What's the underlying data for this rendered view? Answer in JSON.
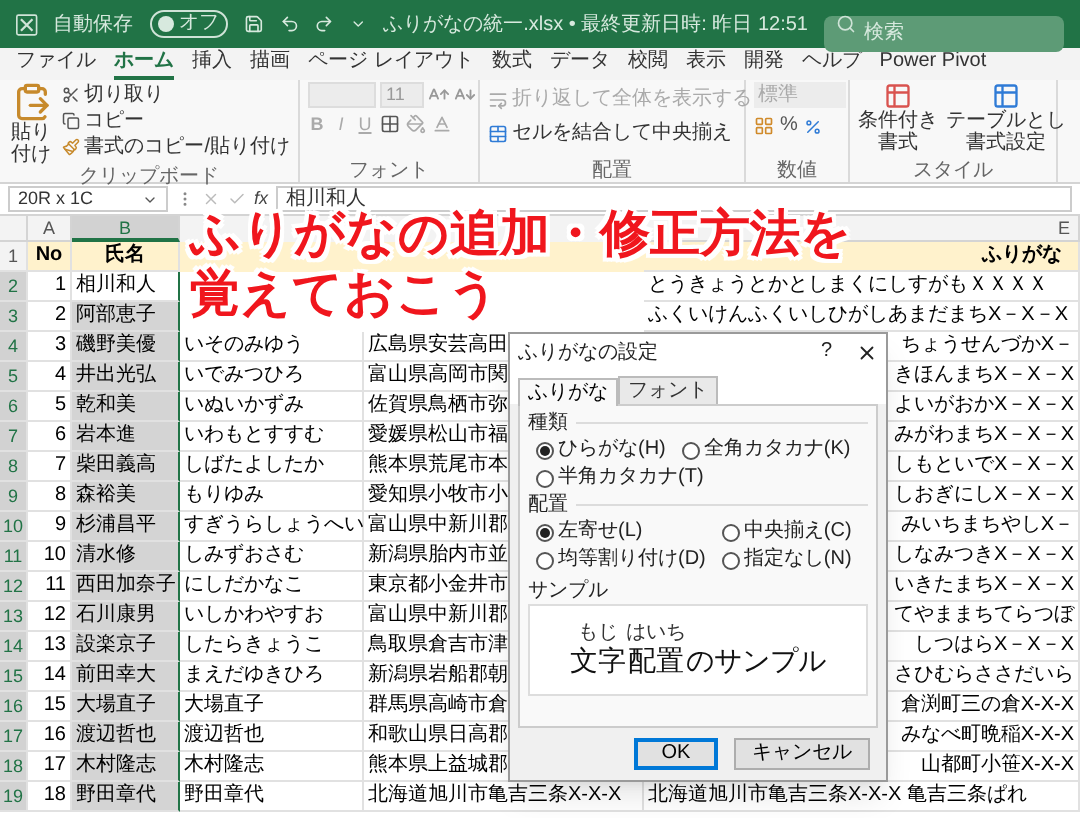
{
  "title_bar": {
    "autosave_label": "自動保存",
    "autosave_state": "オフ",
    "autosave_on": false,
    "file_title": "ふりがなの統一.xlsx • 最終更新日時: 昨日 12:51",
    "search_placeholder": "検索"
  },
  "menu_tabs": [
    {
      "label": "ファイル",
      "selected": false
    },
    {
      "label": "ホーム",
      "selected": true
    },
    {
      "label": "挿入",
      "selected": false
    },
    {
      "label": "描画",
      "selected": false
    },
    {
      "label": "ページ レイアウト",
      "selected": false
    },
    {
      "label": "数式",
      "selected": false
    },
    {
      "label": "データ",
      "selected": false
    },
    {
      "label": "校閲",
      "selected": false
    },
    {
      "label": "表示",
      "selected": false
    },
    {
      "label": "開発",
      "selected": false
    },
    {
      "label": "ヘルプ",
      "selected": false
    },
    {
      "label": "Power Pivot",
      "selected": false
    }
  ],
  "ribbon": {
    "clipboard": {
      "paste": "貼り付け",
      "cut": "切り取り",
      "copy": "コピー",
      "format_painter": "書式のコピー/貼り付け",
      "label": "クリップボード"
    },
    "font": {
      "size": "11",
      "styles": [
        "B",
        "I",
        "U"
      ],
      "label": "フォント"
    },
    "alignment": {
      "wrap": "折り返して全体を表示する",
      "merge": "セルを結合して中央揃え",
      "label": "配置"
    },
    "number": {
      "format": "標準",
      "percent": "%",
      "label": "数値"
    },
    "styles": {
      "conditional": [
        "条件付き",
        "書式"
      ],
      "table": [
        "テーブルとし",
        "書式設定"
      ],
      "label": "スタイル"
    }
  },
  "formula_bar": {
    "name_box": "20R x 1C",
    "function_label": "fx",
    "value": "相川和人"
  },
  "column_headers": {
    "a": {
      "letter": "A",
      "selected": false
    },
    "b": {
      "letter": "B",
      "selected": true
    },
    "e": {
      "letter": "E",
      "selected": false
    }
  },
  "header_row": {
    "row_number": "1",
    "no": "No",
    "name": "氏名",
    "kana2": "ふりがな"
  },
  "rows": [
    {
      "kind": "full",
      "row_number": "2",
      "selected": true,
      "active": true,
      "no": "1",
      "name": "相川和人",
      "kana2": "とうきょうとかとしまくにしすがもＸＸＸＸ"
    },
    {
      "kind": "full",
      "row_number": "3",
      "selected": true,
      "active": false,
      "no": "2",
      "name": "阿部恵子",
      "kana2": "ふくいけんふくいしひがしあまだまちX－X－X"
    },
    {
      "kind": "behind_dialog",
      "row_number": "4",
      "selected": true,
      "active": false,
      "no": "3",
      "name": "磯野美優",
      "kana": "いそのみゆう",
      "address": "広島県安芸高田",
      "kana2": "ちょうせんづかX－"
    },
    {
      "kind": "behind_dialog",
      "row_number": "5",
      "selected": true,
      "active": false,
      "no": "4",
      "name": "井出光弘",
      "kana": "いでみつひろ",
      "address": "富山県高岡市関",
      "kana2": "きほんまちX－X－X"
    },
    {
      "kind": "behind_dialog",
      "row_number": "6",
      "selected": true,
      "active": false,
      "no": "5",
      "name": "乾和美",
      "kana": "いぬいかずみ",
      "address": "佐賀県鳥栖市弥",
      "kana2": "よいがおかX－X－X"
    },
    {
      "kind": "behind_dialog",
      "row_number": "7",
      "selected": true,
      "active": false,
      "no": "6",
      "name": "岩本進",
      "kana": "いわもとすすむ",
      "address": "愛媛県松山市福",
      "kana2": "みがわまちX－X－X"
    },
    {
      "kind": "behind_dialog",
      "row_number": "8",
      "selected": true,
      "active": false,
      "no": "7",
      "name": "柴田義高",
      "kana": "しばたよしたか",
      "address": "熊本県荒尾市本",
      "kana2": "しもといでX－X－X"
    },
    {
      "kind": "behind_dialog",
      "row_number": "9",
      "selected": true,
      "active": false,
      "no": "8",
      "name": "森裕美",
      "kana": "もりゆみ",
      "address": "愛知県小牧市小",
      "kana2": "しおぎにしX－X－X"
    },
    {
      "kind": "behind_dialog",
      "row_number": "10",
      "selected": true,
      "active": false,
      "no": "9",
      "name": "杉浦昌平",
      "kana": "すぎうらしょうへい",
      "address": "富山県中新川郡",
      "kana2": "みいちまちやしX－"
    },
    {
      "kind": "behind_dialog",
      "row_number": "11",
      "selected": true,
      "active": false,
      "no": "10",
      "name": "清水修",
      "kana": "しみずおさむ",
      "address": "新潟県胎内市並",
      "kana2": "しなみつきX－X－X"
    },
    {
      "kind": "behind_dialog",
      "row_number": "12",
      "selected": true,
      "active": false,
      "no": "11",
      "name": "西田加奈子",
      "kana": "にしだかなこ",
      "address": "東京都小金井市",
      "kana2": "いきたまちX－X－X"
    },
    {
      "kind": "behind_dialog",
      "row_number": "13",
      "selected": true,
      "active": false,
      "no": "12",
      "name": "石川康男",
      "kana": "いしかわやすお",
      "address": "富山県中新川郡",
      "kana2": "てやままちてらつぼ"
    },
    {
      "kind": "behind_dialog",
      "row_number": "14",
      "selected": true,
      "active": false,
      "no": "13",
      "name": "設楽京子",
      "kana": "したらきょうこ",
      "address": "鳥取県倉吉市津",
      "kana2": "しつはらX－X－X"
    },
    {
      "kind": "behind_dialog",
      "row_number": "15",
      "selected": true,
      "active": false,
      "no": "14",
      "name": "前田幸大",
      "kana": "まえだゆきひろ",
      "address": "新潟県岩船郡朝",
      "kana2": "さひむらささだいら"
    },
    {
      "kind": "behind_dialog",
      "row_number": "16",
      "selected": true,
      "active": false,
      "no": "15",
      "name": "大場直子",
      "kana": "大場直子",
      "address": "群馬県高崎市倉",
      "kana2": "倉渕町三の倉X-X-X"
    },
    {
      "kind": "behind_dialog",
      "row_number": "17",
      "selected": true,
      "active": false,
      "no": "16",
      "name": "渡辺哲也",
      "kana": "渡辺哲也",
      "address": "和歌山県日高郡",
      "kana2": "みなべ町晩稲X-X-X"
    },
    {
      "kind": "behind_dialog",
      "row_number": "18",
      "selected": true,
      "active": false,
      "no": "17",
      "name": "木村隆志",
      "kana": "木村隆志",
      "address": "熊本県上益城郡",
      "kana2": "山都町小笹X-X-X"
    },
    {
      "kind": "full",
      "row_number": "19",
      "selected": true,
      "active": false,
      "no": "18",
      "name": "野田章代",
      "kana": "野田章代",
      "address": "北海道旭川市亀吉三条X-X-X",
      "kana2": "北海道旭川市亀吉三条X-X-X 亀吉三条ぱれ"
    }
  ],
  "caption": [
    "ふりがなの追加・修正方法を",
    "覚えておこう"
  ],
  "dialog": {
    "title": "ふりがなの設定",
    "help": "?",
    "tabs": [
      {
        "label": "ふりがな",
        "selected": true
      },
      {
        "label": "フォント",
        "selected": false
      }
    ],
    "type_section": {
      "label": "種類",
      "options": [
        {
          "label": "ひらがな(H)",
          "selected": true
        },
        {
          "label": "全角カタカナ(K)",
          "selected": false
        },
        {
          "label": "半角カタカナ(T)",
          "selected": false
        }
      ]
    },
    "align_section": {
      "label": "配置",
      "options": [
        {
          "label": "左寄せ(L)",
          "selected": true
        },
        {
          "label": "中央揃え(C)",
          "selected": false
        },
        {
          "label": "均等割り付け(D)",
          "selected": false
        },
        {
          "label": "指定なし(N)",
          "selected": false
        }
      ]
    },
    "sample": {
      "label": "サンプル",
      "ruby": [
        {
          "base": "文字",
          "reading": "もじ"
        },
        {
          "base": "配置",
          "reading": "はいち"
        }
      ],
      "rest": "のサンプル"
    },
    "buttons": [
      {
        "label": "OK",
        "kind": "primary"
      },
      {
        "label": "キャンセル",
        "kind": "normal"
      }
    ]
  }
}
